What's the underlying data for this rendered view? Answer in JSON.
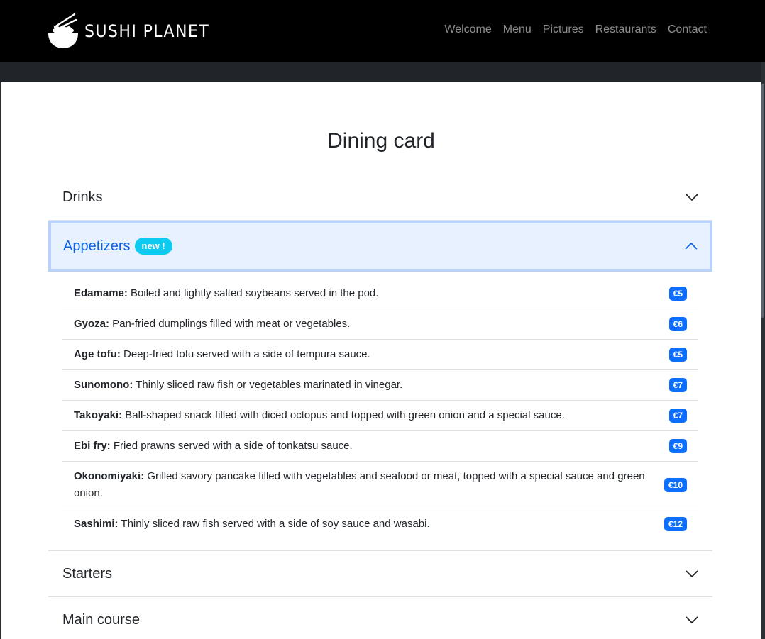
{
  "brand": {
    "name": "SUSHI PLANET",
    "logo_icon": "sushi-bowl-icon"
  },
  "nav": {
    "links": [
      "Welcome",
      "Menu",
      "Pictures",
      "Restaurants",
      "Contact"
    ]
  },
  "page": {
    "title": "Dining card"
  },
  "accordion": {
    "sections": [
      {
        "label": "Drinks",
        "expanded": false
      },
      {
        "label": "Appetizers",
        "badge": "new !",
        "expanded": true
      },
      {
        "label": "Starters",
        "expanded": false
      },
      {
        "label": "Main course",
        "expanded": false
      }
    ],
    "appetizers": [
      {
        "name": "Edamame:",
        "description": " Boiled and lightly salted soybeans served in the pod.",
        "price": "€5"
      },
      {
        "name": "Gyoza:",
        "description": " Pan-fried dumplings filled with meat or vegetables.",
        "price": "€6"
      },
      {
        "name": "Age tofu:",
        "description": " Deep-fried tofu served with a side of tempura sauce.",
        "price": "€5"
      },
      {
        "name": "Sunomono:",
        "description": " Thinly sliced raw fish or vegetables marinated in vinegar.",
        "price": "€7"
      },
      {
        "name": "Takoyaki:",
        "description": " Ball-shaped snack filled with diced octopus and topped with green onion and a special sauce.",
        "price": "€7"
      },
      {
        "name": "Ebi fry:",
        "description": " Fried prawns served with a side of tonkatsu sauce.",
        "price": "€9"
      },
      {
        "name": "Okonomiyaki:",
        "description": " Grilled savory pancake filled with vegetables and seafood or meat, topped with a special sauce and green onion.",
        "price": "€10"
      },
      {
        "name": "Sashimi:",
        "description": " Thinly sliced raw fish served with a side of soy sauce and wasabi.",
        "price": "€12"
      }
    ]
  },
  "colors": {
    "navbar_bg": "#000000",
    "accent": "#0c63e4",
    "active_bg": "#e7f1ff",
    "badge_new": "#0dcaf0",
    "badge_price": "#0d6efd"
  }
}
